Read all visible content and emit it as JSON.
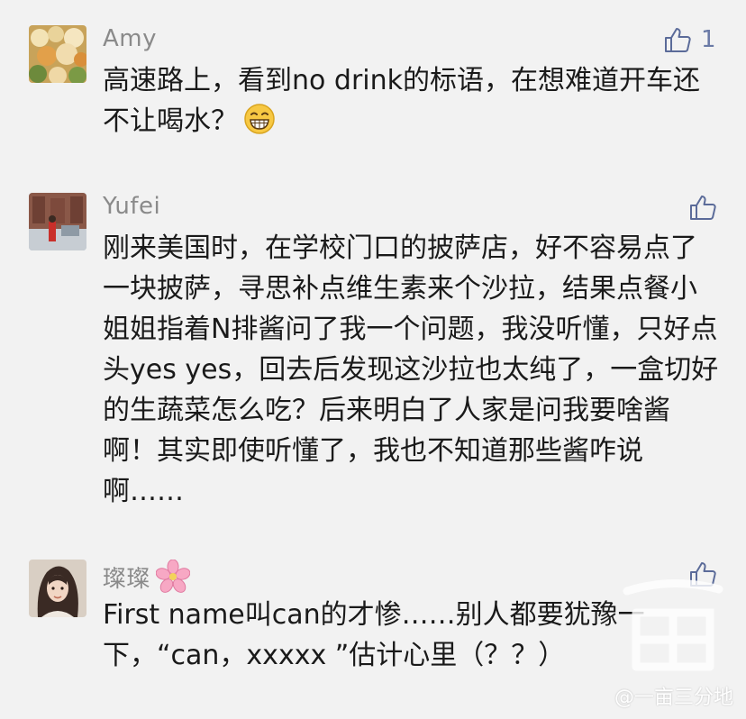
{
  "comments": [
    {
      "name": "Amy",
      "text": "高速路上，看到no drink的标语，在想难道开车还不让喝水？",
      "like_count": "1"
    },
    {
      "name": "Yufei",
      "text": "刚来美国时，在学校门口的披萨店，好不容易点了一块披萨，寻思补点维生素来个沙拉，结果点餐小姐姐指着N排酱问了我一个问题，我没听懂，只好点头yes yes，回去后发现这沙拉也太纯了，一盒切好的生蔬菜怎么吃？后来明白了人家是问我要啥酱啊！其实即使听懂了，我也不知道那些酱咋说啊……",
      "like_count": ""
    },
    {
      "name": "璨璨",
      "text": "First name叫can的才惨……别人都要犹豫一下，“can，xxxxx ”估计心里（？？）",
      "like_count": ""
    }
  ],
  "watermark": "@一亩三分地",
  "colors": {
    "background": "#f2f2f2",
    "name": "#8a8a8a",
    "like_icon": "#5b6b99"
  }
}
